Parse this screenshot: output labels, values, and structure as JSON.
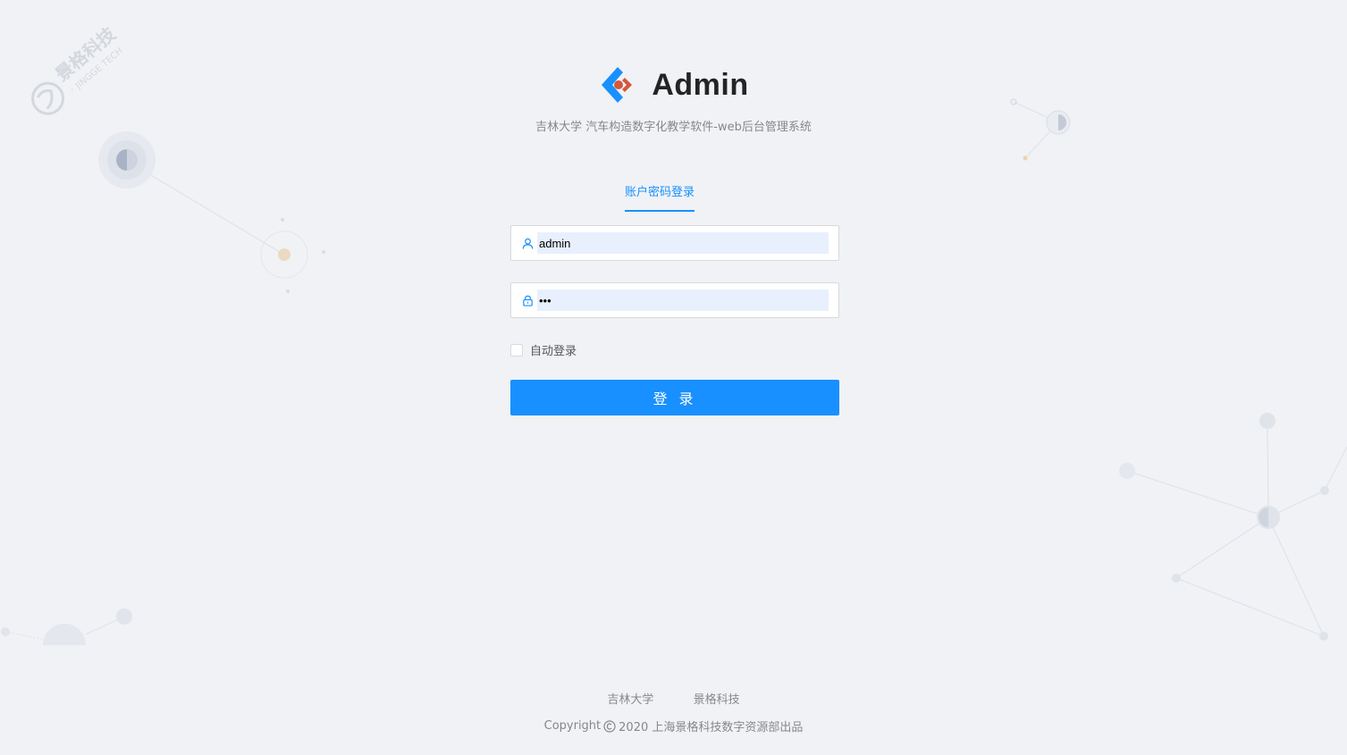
{
  "brand": {
    "title": "Admin",
    "subtitle": "吉林大学 汽车构造数字化教学软件-web后台管理系统"
  },
  "watermark": {
    "text_cn": "景格科技",
    "text_en": "JINGGE TECH"
  },
  "login": {
    "tab_label": "账户密码登录",
    "username_value": "admin",
    "password_value": "•••",
    "remember_label": "自动登录",
    "submit_label": "登 录"
  },
  "footer": {
    "links": [
      "吉林大学",
      "景格科技"
    ],
    "copyright_prefix": "Copyright",
    "copyright_suffix": "2020 上海景格科技数字资源部出品"
  },
  "colors": {
    "primary": "#1890ff",
    "background": "#f0f2f5",
    "logo_orange": "#d4573c"
  }
}
